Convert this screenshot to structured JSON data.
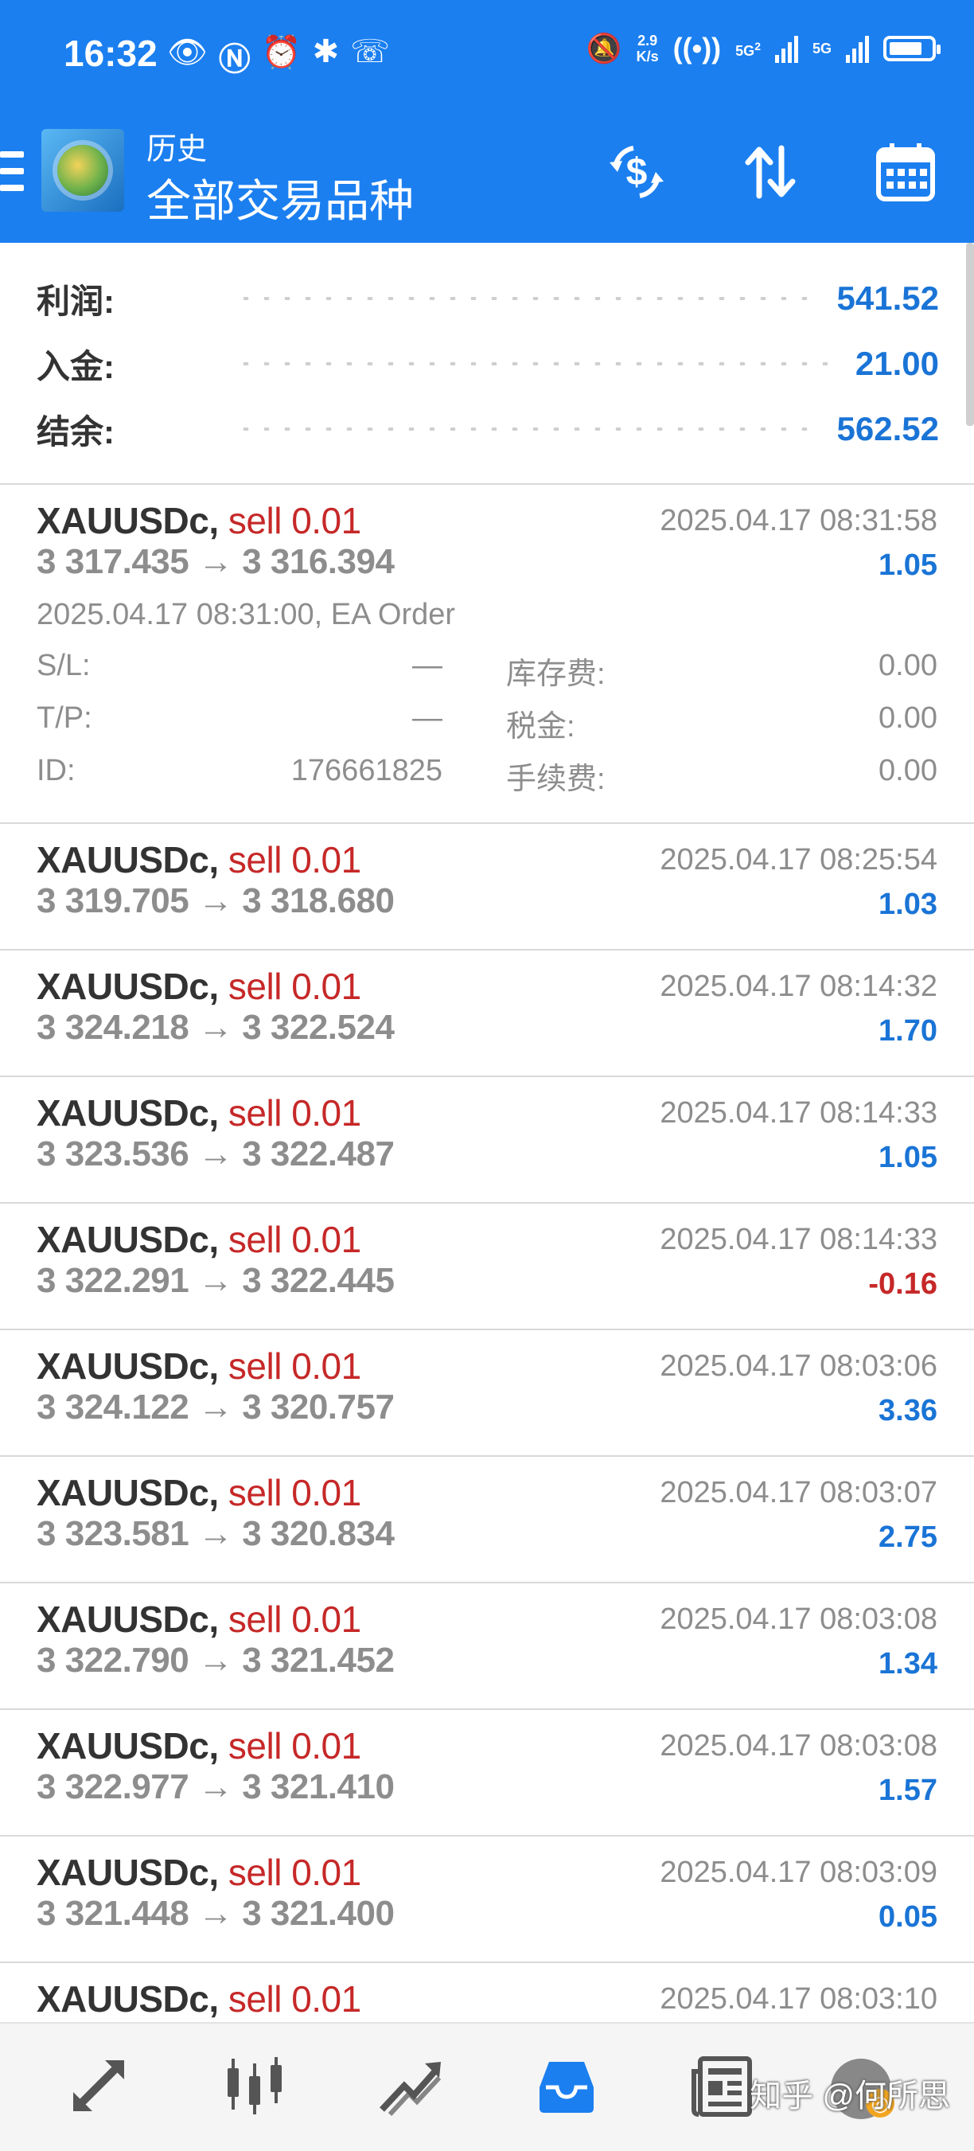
{
  "status_bar": {
    "time": "16:32",
    "net_speed_value": "2.9",
    "net_speed_unit": "K/s",
    "sim2_label": "5G",
    "sim2_super": "2",
    "sim1_label": "5G",
    "left_icons": [
      "eye-icon",
      "nfc-icon",
      "alarm-icon",
      "bluetooth-icon",
      "missed-call-icon"
    ],
    "right_icons": [
      "mute-bell-icon",
      "hotspot-icon",
      "signal-icon",
      "battery-icon"
    ]
  },
  "toolbar": {
    "subtitle": "历史",
    "title": "全部交易品种",
    "actions": [
      "dollar-sync-icon",
      "sort-icon",
      "calendar-icon"
    ]
  },
  "summary": [
    {
      "label": "利润:",
      "value": "541.52"
    },
    {
      "label": "入金:",
      "value": "21.00"
    },
    {
      "label": "结余:",
      "value": "562.52"
    }
  ],
  "expanded_trade": {
    "symbol": "XAUUSDc,",
    "side": "sell 0.01",
    "prices": "3 317.435 → 3 316.394",
    "time": "2025.04.17 08:31:58",
    "profit": "1.05",
    "open_info": "2025.04.17 08:31:00, EA Order",
    "details": [
      {
        "k1": "S/L:",
        "v1": "—",
        "k2": "库存费:",
        "v2": "0.00"
      },
      {
        "k1": "T/P:",
        "v1": "—",
        "k2": "税金:",
        "v2": "0.00"
      },
      {
        "k1": "ID:",
        "v1": "176661825",
        "k2": "手续费:",
        "v2": "0.00"
      }
    ]
  },
  "trades": [
    {
      "symbol": "XAUUSDc,",
      "side": "sell 0.01",
      "prices": "3 319.705 → 3 318.680",
      "time": "2025.04.17 08:25:54",
      "profit": "1.03",
      "negative": false
    },
    {
      "symbol": "XAUUSDc,",
      "side": "sell 0.01",
      "prices": "3 324.218 → 3 322.524",
      "time": "2025.04.17 08:14:32",
      "profit": "1.70",
      "negative": false
    },
    {
      "symbol": "XAUUSDc,",
      "side": "sell 0.01",
      "prices": "3 323.536 → 3 322.487",
      "time": "2025.04.17 08:14:33",
      "profit": "1.05",
      "negative": false
    },
    {
      "symbol": "XAUUSDc,",
      "side": "sell 0.01",
      "prices": "3 322.291 → 3 322.445",
      "time": "2025.04.17 08:14:33",
      "profit": "-0.16",
      "negative": true
    },
    {
      "symbol": "XAUUSDc,",
      "side": "sell 0.01",
      "prices": "3 324.122 → 3 320.757",
      "time": "2025.04.17 08:03:06",
      "profit": "3.36",
      "negative": false
    },
    {
      "symbol": "XAUUSDc,",
      "side": "sell 0.01",
      "prices": "3 323.581 → 3 320.834",
      "time": "2025.04.17 08:03:07",
      "profit": "2.75",
      "negative": false
    },
    {
      "symbol": "XAUUSDc,",
      "side": "sell 0.01",
      "prices": "3 322.790 → 3 321.452",
      "time": "2025.04.17 08:03:08",
      "profit": "1.34",
      "negative": false
    },
    {
      "symbol": "XAUUSDc,",
      "side": "sell 0.01",
      "prices": "3 322.977 → 3 321.410",
      "time": "2025.04.17 08:03:08",
      "profit": "1.57",
      "negative": false
    },
    {
      "symbol": "XAUUSDc,",
      "side": "sell 0.01",
      "prices": "3 321.448 → 3 321.400",
      "time": "2025.04.17 08:03:09",
      "profit": "0.05",
      "negative": false
    },
    {
      "symbol": "XAUUSDc,",
      "side": "sell 0.01",
      "prices": "",
      "time": "2025.04.17 08:03:10",
      "profit": "",
      "negative": false
    }
  ],
  "bottom_nav": {
    "items": [
      "quotes-icon",
      "chart-icon",
      "trade-icon",
      "history-icon",
      "news-icon"
    ],
    "active_index": 3,
    "active_color": "#1b7ff0"
  },
  "watermark": {
    "text": "知乎 @何所思"
  },
  "colors": {
    "accent": "#1b7ff0",
    "profit_positive": "#1a74d6",
    "profit_negative": "#c62828",
    "sell": "#c62828"
  }
}
